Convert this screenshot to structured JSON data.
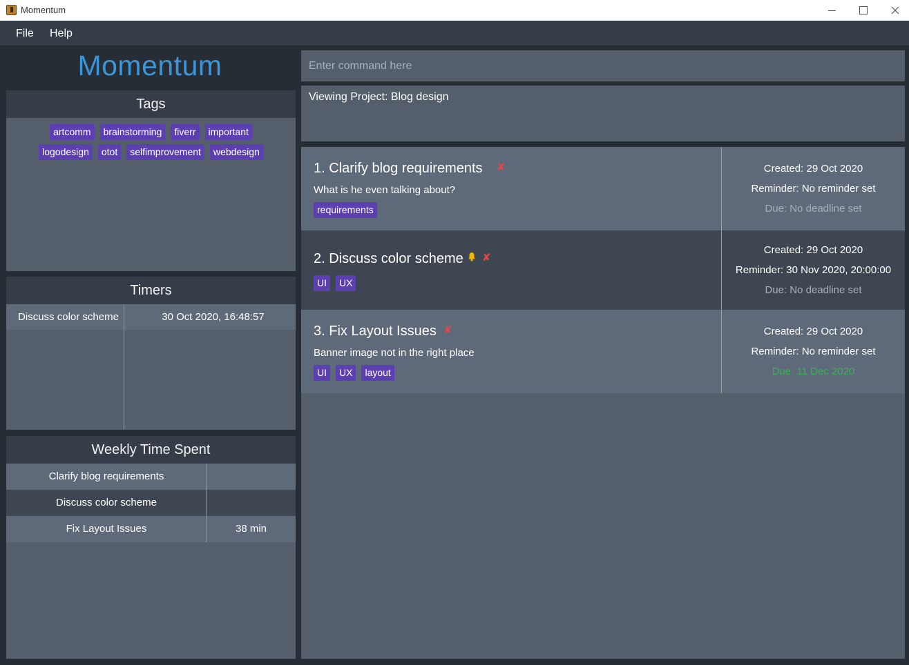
{
  "window": {
    "title": "Momentum"
  },
  "menu": {
    "file": "File",
    "help": "Help"
  },
  "brand": "Momentum",
  "tags_panel": {
    "header": "Tags",
    "tags": [
      "artcomm",
      "brainstorming",
      "fiverr",
      "important",
      "logodesign",
      "otot",
      "selfimprovement",
      "webdesign"
    ]
  },
  "timers_panel": {
    "header": "Timers",
    "rows": [
      {
        "name": "Discuss color scheme",
        "time": "30 Oct 2020, 16:48:57"
      }
    ]
  },
  "weekly_panel": {
    "header": "Weekly Time Spent",
    "rows": [
      {
        "name": "Clarify blog requirements",
        "time": ""
      },
      {
        "name": "Discuss color scheme",
        "time": ""
      },
      {
        "name": "Fix Layout Issues",
        "time": "38 min"
      }
    ]
  },
  "command": {
    "placeholder": "Enter command here"
  },
  "result": {
    "text": "Viewing Project: Blog design"
  },
  "tasks": [
    {
      "title": "1. Clarify blog requirements",
      "description": "What is he even talking about?",
      "tags": [
        "requirements"
      ],
      "created": "Created: 29 Oct 2020",
      "reminder": "Reminder: No reminder set",
      "due": "Due: No deadline set"
    },
    {
      "title": "2. Discuss color scheme",
      "description": "",
      "tags": [
        "UI",
        "UX"
      ],
      "created": "Created: 29 Oct 2020",
      "reminder": "Reminder: 30 Nov 2020, 20:00:00",
      "due": "Due: No deadline set"
    },
    {
      "title": "3. Fix Layout Issues",
      "description": "Banner image not in the right place",
      "tags": [
        "UI",
        "UX",
        "layout"
      ],
      "created": "Created: 29 Oct 2020",
      "reminder": "Reminder: No reminder set",
      "due": "Due: 11 Dec 2020"
    }
  ],
  "icons": {
    "delete": "✘",
    "bell": "bell-icon"
  },
  "colors": {
    "brand": "#3c95d8",
    "tag": "#5c3fb0",
    "due_set": "#3fae5a",
    "delete": "#e84646",
    "bell": "#f4b400"
  }
}
